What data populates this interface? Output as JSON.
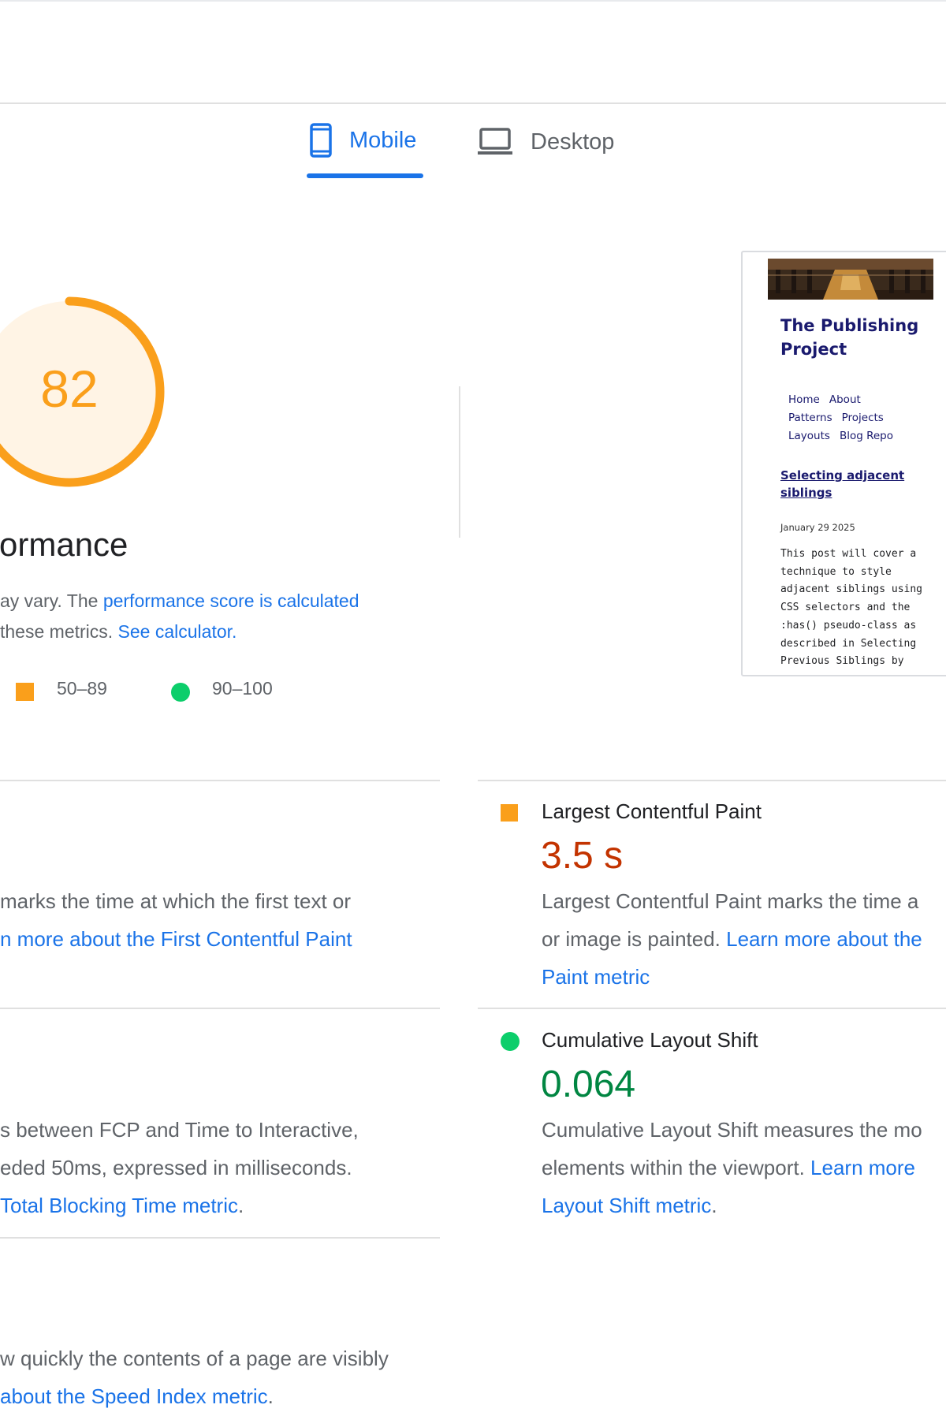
{
  "tabs": {
    "mobile": "Mobile",
    "desktop": "Desktop",
    "selected": "Mobile"
  },
  "colors": {
    "accent": "#1a73e8",
    "average": "#fa9f1b",
    "good": "#0cce6b",
    "poor_text": "#c33300",
    "good_text": "#018642"
  },
  "score": {
    "value": "82",
    "fraction": 0.82,
    "title": "erformance",
    "desc_line1_prefix": "ay vary. The ",
    "desc_line1_link": "performance score is calculated",
    "desc_line2_prefix": "these metrics. ",
    "desc_line2_link": "See calculator."
  },
  "legend": {
    "average": "50–89",
    "good": "90–100",
    "average_icon": "orange-square",
    "good_icon": "green-circle"
  },
  "thumbnail": {
    "title": "The Publishing Project",
    "nav": [
      "Home",
      "About",
      "Patterns",
      "Projects",
      "Layouts",
      "Blog Repo"
    ],
    "post_title": "Selecting adjacent siblings",
    "date": "January 29 2025",
    "excerpt": "This post will cover a technique to style adjacent siblings using CSS selectors and the :has() pseudo-class as described in Selecting Previous Siblings by"
  },
  "metrics": {
    "fcp": {
      "line1": "marks the time at which the first text or",
      "line2_link": "n more about the First Contentful Paint"
    },
    "tbt": {
      "line1": "s between FCP and Time to Interactive,",
      "line2": "eded 50ms, expressed in milliseconds.",
      "line3_link": "Total Blocking Time metric",
      "line3_suffix": "."
    },
    "si": {
      "line1": "w quickly the contents of a page are visibly",
      "line2_link": "about the Speed Index metric",
      "line2_suffix": "."
    },
    "lcp": {
      "label": "Largest Contentful Paint",
      "value": "3.5 s",
      "line1": "Largest Contentful Paint marks the time a",
      "line2_prefix": "or image is painted. ",
      "line2_link": "Learn more about the",
      "line3_link": "Paint metric"
    },
    "cls": {
      "label": "Cumulative Layout Shift",
      "value": "0.064",
      "line1": "Cumulative Layout Shift measures the mo",
      "line2_prefix": "elements within the viewport. ",
      "line2_link": "Learn more",
      "line3_link": "Layout Shift metric",
      "line3_suffix": "."
    }
  }
}
